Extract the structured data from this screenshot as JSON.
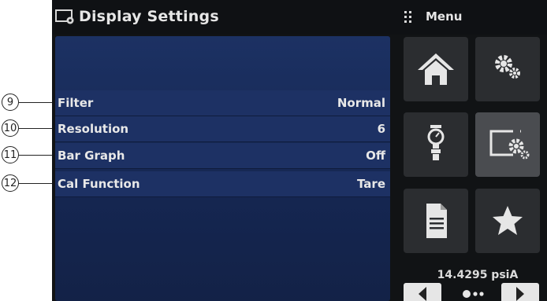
{
  "screen": {
    "title": "Display Settings",
    "title_icon": "display-settings-icon",
    "menu_label": "Menu",
    "menu_icon": "menu-grid-icon"
  },
  "settings": [
    {
      "callout": "9",
      "label": "Filter",
      "value": "Normal"
    },
    {
      "callout": "10",
      "label": "Resolution",
      "value": "6"
    },
    {
      "callout": "11",
      "label": "Bar Graph",
      "value": "Off"
    },
    {
      "callout": "12",
      "label": "Cal Function",
      "value": "Tare"
    }
  ],
  "menu_tiles": [
    {
      "icon": "home-icon"
    },
    {
      "icon": "gears-settings-icon"
    },
    {
      "icon": "pressure-sensor-icon"
    },
    {
      "icon": "display-settings-icon",
      "active": true
    },
    {
      "icon": "document-icon"
    },
    {
      "icon": "star-icon"
    }
  ],
  "readout": "14.4295 psiA",
  "nav": {
    "left_icon": "arrow-left-icon",
    "right_icon": "arrow-right-icon",
    "pager_icon": "page-indicator-icon"
  },
  "colors": {
    "panel_blue": "#1c3163",
    "screen_black": "#111315",
    "tile_gray": "#2b2d30",
    "tile_active": "#4a4c50"
  }
}
